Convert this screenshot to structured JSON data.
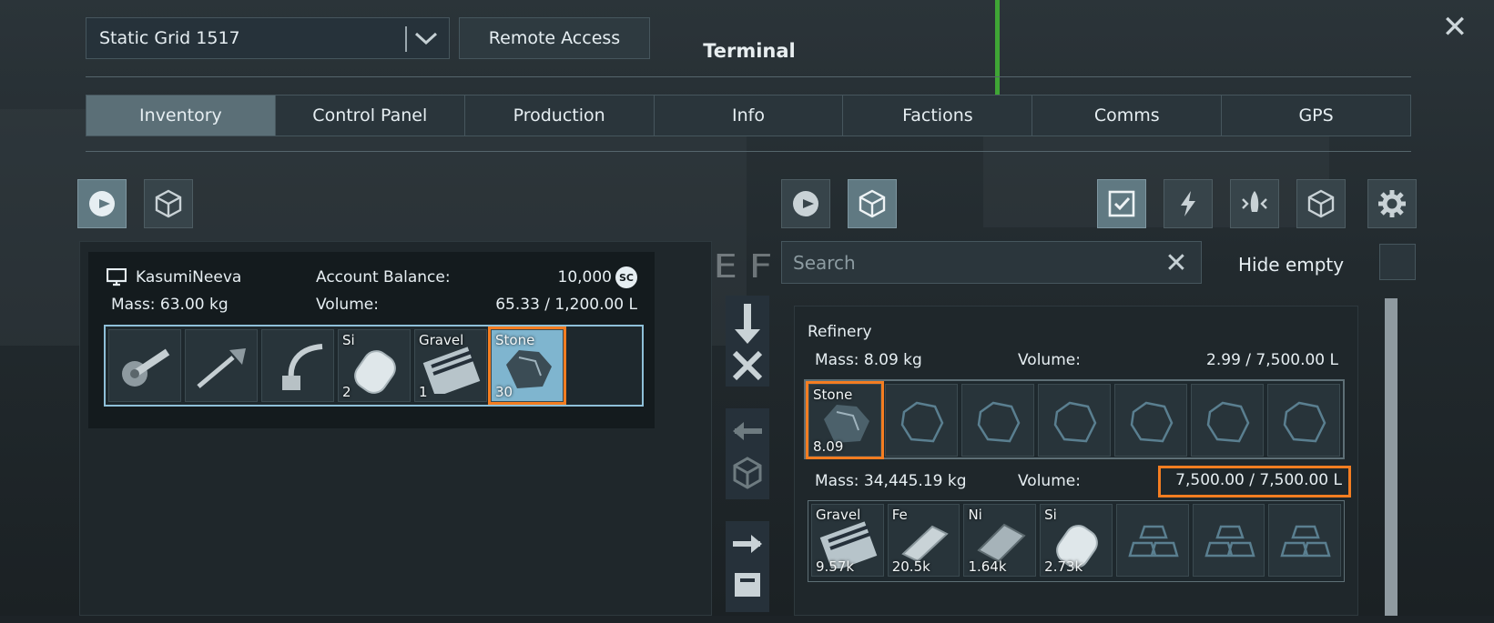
{
  "header": {
    "grid_select": "Static Grid 1517",
    "remote_access": "Remote Access",
    "title": "Terminal",
    "close": "✕"
  },
  "tabs": [
    "Inventory",
    "Control Panel",
    "Production",
    "Info",
    "Factions",
    "Comms",
    "GPS"
  ],
  "left": {
    "user": "KasumiNeeva",
    "balance_label": "Account Balance:",
    "balance_value": "10,000",
    "currency": "SC",
    "mass": "Mass: 63.00 kg",
    "volume_label": "Volume:",
    "volume_value": "65.33 / 1,200.00 L",
    "slots": [
      {
        "label": "",
        "count": "",
        "icon": "angle-grinder-icon"
      },
      {
        "label": "",
        "count": "",
        "icon": "hand-drill-icon"
      },
      {
        "label": "",
        "count": "",
        "icon": "welder-icon"
      },
      {
        "label": "Si",
        "count": "2",
        "icon": "silicon-ingot-icon"
      },
      {
        "label": "Gravel",
        "count": "1",
        "icon": "gravel-icon"
      },
      {
        "label": "Stone",
        "count": "30",
        "icon": "stone-ore-icon",
        "highlight": true
      }
    ]
  },
  "right": {
    "search_placeholder": "Search",
    "hide_empty": "Hide empty",
    "refinery_title": "Refinery",
    "input_mass": "Mass: 8.09 kg",
    "input_volume_label": "Volume:",
    "input_volume_value": "2.99 / 7,500.00 L",
    "input_slots": [
      {
        "label": "Stone",
        "count": "8.09",
        "icon": "stone-ore-icon",
        "highlight": true
      }
    ],
    "output_mass": "Mass: 34,445.19 kg",
    "output_volume_label": "Volume:",
    "output_volume_value": "7,500.00 / 7,500.00 L",
    "output_slots": [
      {
        "label": "Gravel",
        "count": "9.57k",
        "icon": "gravel-icon"
      },
      {
        "label": "Fe",
        "count": "20.5k",
        "icon": "iron-ingot-icon"
      },
      {
        "label": "Ni",
        "count": "1.64k",
        "icon": "nickel-ingot-icon"
      },
      {
        "label": "Si",
        "count": "2.73k",
        "icon": "silicon-ingot-icon"
      }
    ]
  },
  "background_text": "REFINERY",
  "colors": {
    "highlight": "#f47d21",
    "active_tab": "#5b6f77",
    "accent_green": "#3fa535"
  }
}
